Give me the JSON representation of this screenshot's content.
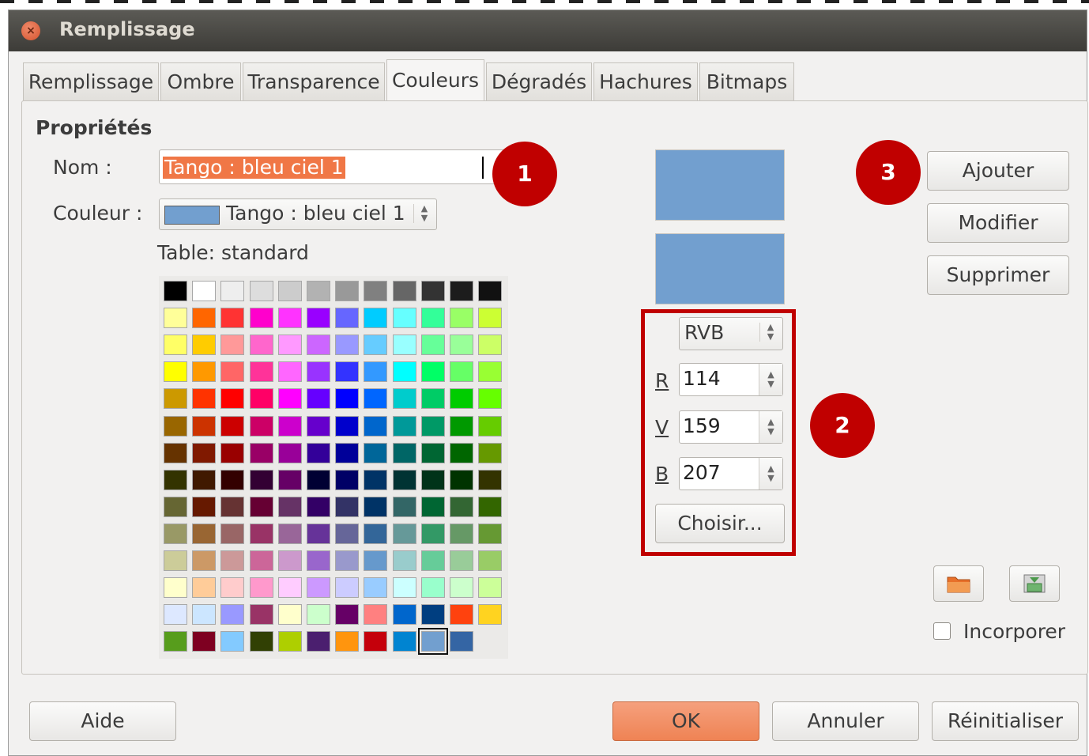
{
  "window": {
    "title": "Remplissage"
  },
  "tabs": [
    {
      "label": "Remplissage"
    },
    {
      "label": "Ombre"
    },
    {
      "label": "Transparence"
    },
    {
      "label": "Couleurs",
      "active": true
    },
    {
      "label": "Dégradés"
    },
    {
      "label": "Hachures"
    },
    {
      "label": "Bitmaps"
    }
  ],
  "properties": {
    "heading": "Propriétés",
    "name_label": "Nom :",
    "name_value": "Tango : bleu ciel 1",
    "color_label": "Couleur :",
    "color_value": "Tango : bleu ciel 1",
    "color_swatch": "#729fcf",
    "table_label": "Table: standard"
  },
  "palette": [
    [
      "#000000",
      "#ffffff",
      "#eeeeee",
      "#dddddd",
      "#cccccc",
      "#b2b2b2",
      "#999999",
      "#808080",
      "#666666",
      "#333333",
      "#1c1c1c",
      "#111111"
    ],
    [
      "#ffff99",
      "#ff6600",
      "#ff3333",
      "#ff00cc",
      "#ff33ff",
      "#9900ff",
      "#6666ff",
      "#00ccff",
      "#66ffff",
      "#33ff99",
      "#99ff66",
      "#ccff33"
    ],
    [
      "#ffff66",
      "#ffcc00",
      "#ff9999",
      "#ff66cc",
      "#ff99ff",
      "#cc66ff",
      "#9999ff",
      "#66ccff",
      "#99ffff",
      "#66ff99",
      "#99ff99",
      "#ccff66"
    ],
    [
      "#ffff00",
      "#ff9900",
      "#ff6666",
      "#ff3399",
      "#ff66ff",
      "#9933ff",
      "#3333ff",
      "#3399ff",
      "#00ffff",
      "#00ff66",
      "#66ff66",
      "#99ff33"
    ],
    [
      "#cc9900",
      "#ff3300",
      "#ff0000",
      "#ff0066",
      "#ff00ff",
      "#6600ff",
      "#0000ff",
      "#0066ff",
      "#00cccc",
      "#00cc66",
      "#00cc00",
      "#66ff00"
    ],
    [
      "#996600",
      "#cc3300",
      "#cc0000",
      "#cc0066",
      "#cc00cc",
      "#6600cc",
      "#0000cc",
      "#0066cc",
      "#009999",
      "#009966",
      "#009900",
      "#66cc00"
    ],
    [
      "#663300",
      "#801900",
      "#990000",
      "#990066",
      "#990099",
      "#330099",
      "#000099",
      "#006699",
      "#006666",
      "#006633",
      "#006600",
      "#669900"
    ],
    [
      "#333300",
      "#401900",
      "#330000",
      "#330033",
      "#660066",
      "#000033",
      "#000066",
      "#003366",
      "#003333",
      "#003319",
      "#003300",
      "#333300"
    ],
    [
      "#666633",
      "#661900",
      "#663333",
      "#660033",
      "#663366",
      "#330066",
      "#333366",
      "#003366",
      "#336666",
      "#006633",
      "#336633",
      "#336600"
    ],
    [
      "#999966",
      "#996633",
      "#996666",
      "#993366",
      "#996699",
      "#663399",
      "#666699",
      "#336699",
      "#669999",
      "#339966",
      "#669966",
      "#669933"
    ],
    [
      "#cccc99",
      "#cc9966",
      "#cc9999",
      "#cc6699",
      "#cc99cc",
      "#9966cc",
      "#9999cc",
      "#6699cc",
      "#99cccc",
      "#66cc99",
      "#99cc99",
      "#99cc66"
    ],
    [
      "#ffffcc",
      "#ffcc99",
      "#ffcccc",
      "#ff99cc",
      "#ffccff",
      "#cc99ff",
      "#ccccff",
      "#99ccff",
      "#ccffff",
      "#99ffcc",
      "#ccffcc",
      "#ccff99"
    ],
    [
      "#dde8ff",
      "#cce6ff",
      "#9999ff",
      "#993366",
      "#ffffcc",
      "#ccffcc",
      "#660066",
      "#ff8080",
      "#0066cc",
      "#003e80",
      "#ff420e",
      "#ffd320"
    ],
    [
      "#579d1c",
      "#7e0021",
      "#83caff",
      "#314004",
      "#aecf00",
      "#4b1f6f",
      "#ff950e",
      "#c5000b",
      "#0084d1",
      "#729fcf",
      "#3465a4",
      null
    ]
  ],
  "selected_cell": {
    "row": 13,
    "col": 9
  },
  "preview": {
    "old_color": "#729fcf",
    "new_color": "#729fcf"
  },
  "color_model": {
    "mode": "RVB",
    "r_label": "R",
    "r_value": "114",
    "v_label": "V",
    "v_value": "159",
    "b_label": "B",
    "b_value": "207",
    "choose_label": "Choisir..."
  },
  "actions": {
    "add": "Ajouter",
    "modify": "Modifier",
    "delete": "Supprimer"
  },
  "embed_label": "Incorporer",
  "footer": {
    "help": "Aide",
    "ok": "OK",
    "cancel": "Annuler",
    "reset": "Réinitialiser"
  },
  "badges": {
    "one": "1",
    "two": "2",
    "three": "3"
  },
  "colors": {
    "accent_red": "#c00000",
    "ok_button": "#ef8354",
    "selection": "#f07746"
  }
}
